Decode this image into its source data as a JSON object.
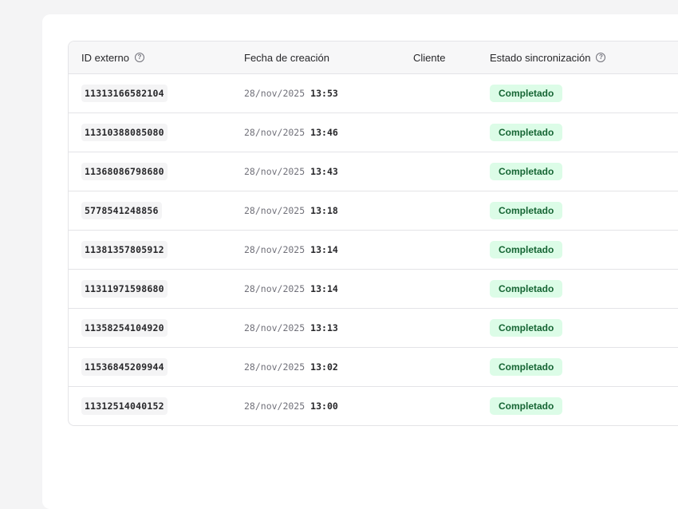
{
  "table": {
    "headers": {
      "id": "ID externo",
      "date": "Fecha de creación",
      "client": "Cliente",
      "status": "Estado sincronización"
    },
    "rows": [
      {
        "id": "11313166582104",
        "date": "28/nov/2025",
        "time": "13:53",
        "client": "",
        "status": "Completado"
      },
      {
        "id": "11310388085080",
        "date": "28/nov/2025",
        "time": "13:46",
        "client": "",
        "status": "Completado"
      },
      {
        "id": "11368086798680",
        "date": "28/nov/2025",
        "time": "13:43",
        "client": "",
        "status": "Completado"
      },
      {
        "id": "5778541248856",
        "date": "28/nov/2025",
        "time": "13:18",
        "client": "",
        "status": "Completado"
      },
      {
        "id": "11381357805912",
        "date": "28/nov/2025",
        "time": "13:14",
        "client": "",
        "status": "Completado"
      },
      {
        "id": "11311971598680",
        "date": "28/nov/2025",
        "time": "13:14",
        "client": "",
        "status": "Completado"
      },
      {
        "id": "11358254104920",
        "date": "28/nov/2025",
        "time": "13:13",
        "client": "",
        "status": "Completado"
      },
      {
        "id": "11536845209944",
        "date": "28/nov/2025",
        "time": "13:02",
        "client": "",
        "status": "Completado"
      },
      {
        "id": "11312514040152",
        "date": "28/nov/2025",
        "time": "13:00",
        "client": "",
        "status": "Completado"
      }
    ]
  },
  "icons": {
    "help": "?"
  },
  "colors": {
    "status_bg": "#dcfce7",
    "status_text": "#166534"
  }
}
